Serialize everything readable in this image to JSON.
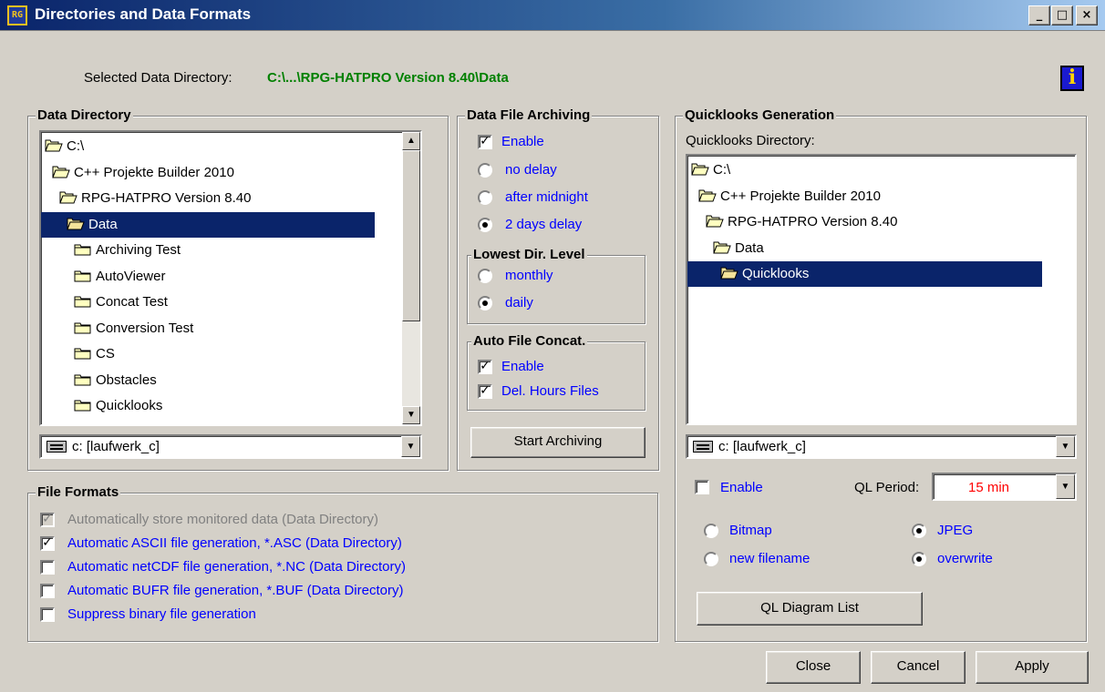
{
  "window": {
    "title": "Directories and Data Formats",
    "icon_name": "app-icon",
    "controls": {
      "minimize": "_",
      "maximize": "□",
      "close": "×"
    }
  },
  "selected_dir": {
    "label": "Selected Data Directory:",
    "value": "C:\\...\\RPG-HATPRO Version 8.40\\Data",
    "value_color": "#008000"
  },
  "data_directory": {
    "legend": "Data Directory",
    "tree": [
      {
        "label": "C:\\",
        "depth": 0,
        "open": true
      },
      {
        "label": "C++ Projekte Builder 2010",
        "depth": 1,
        "open": true
      },
      {
        "label": "RPG-HATPRO Version 8.40",
        "depth": 2,
        "open": true
      },
      {
        "label": "Data",
        "depth": 3,
        "open": true,
        "selected": true
      },
      {
        "label": "Archiving Test",
        "depth": 4
      },
      {
        "label": "AutoViewer",
        "depth": 4
      },
      {
        "label": "Concat Test",
        "depth": 4
      },
      {
        "label": "Conversion Test",
        "depth": 4
      },
      {
        "label": "CS",
        "depth": 4
      },
      {
        "label": "Obstacles",
        "depth": 4
      },
      {
        "label": "Quicklooks",
        "depth": 4
      }
    ],
    "drive": "c: [laufwerk_c]"
  },
  "archiving": {
    "legend": "Data File Archiving",
    "enable_label": "Enable",
    "enable_checked": true,
    "delay_options": [
      {
        "label": "no delay",
        "selected": false
      },
      {
        "label": "after midnight",
        "selected": false
      },
      {
        "label": "2 days delay",
        "selected": true
      }
    ],
    "lowest_level": {
      "legend": "Lowest Dir. Level",
      "options": [
        {
          "label": "monthly",
          "selected": false
        },
        {
          "label": "daily",
          "selected": true
        }
      ]
    },
    "auto_concat": {
      "legend": "Auto File Concat.",
      "enable_label": "Enable",
      "enable_checked": true,
      "delete_label": "Del. Hours Files",
      "delete_checked": true
    },
    "start_button": "Start Archiving"
  },
  "quicklooks": {
    "legend": "Quicklooks Generation",
    "dir_label": "Quicklooks Directory:",
    "tree": [
      {
        "label": "C:\\",
        "depth": 0,
        "open": true
      },
      {
        "label": "C++ Projekte Builder 2010",
        "depth": 1,
        "open": true
      },
      {
        "label": "RPG-HATPRO Version 8.40",
        "depth": 2,
        "open": true
      },
      {
        "label": "Data",
        "depth": 3,
        "open": true
      },
      {
        "label": "Quicklooks",
        "depth": 4,
        "open": true,
        "selected": true
      }
    ],
    "drive": "c: [laufwerk_c]",
    "enable_label": "Enable",
    "enable_checked": false,
    "period_label": "QL Period:",
    "period_value": "15 min",
    "period_color": "#ff0000",
    "format_options": [
      {
        "label": "Bitmap",
        "selected": false
      },
      {
        "label": "JPEG",
        "selected": true
      }
    ],
    "name_options": [
      {
        "label": "new filename",
        "selected": false
      },
      {
        "label": "overwrite",
        "selected": true
      }
    ],
    "diagram_button": "QL Diagram List"
  },
  "file_formats": {
    "legend": "File Formats",
    "items": [
      {
        "label": "Automatically store monitored data (Data Directory)",
        "checked": true,
        "disabled": true
      },
      {
        "label": "Automatic ASCII file generation, *.ASC (Data Directory)",
        "checked": true,
        "disabled": false
      },
      {
        "label": "Automatic netCDF file generation, *.NC (Data Directory)",
        "checked": false,
        "disabled": false
      },
      {
        "label": "Automatic BUFR file generation, *.BUF (Data Directory)",
        "checked": false,
        "disabled": false
      },
      {
        "label": "Suppress binary file generation",
        "checked": false,
        "disabled": false
      }
    ]
  },
  "footer": {
    "close": "Close",
    "cancel": "Cancel",
    "apply": "Apply"
  },
  "colors": {
    "accent_blue": "#0000ff",
    "selection": "#0a246a",
    "face": "#d4d0c8"
  }
}
